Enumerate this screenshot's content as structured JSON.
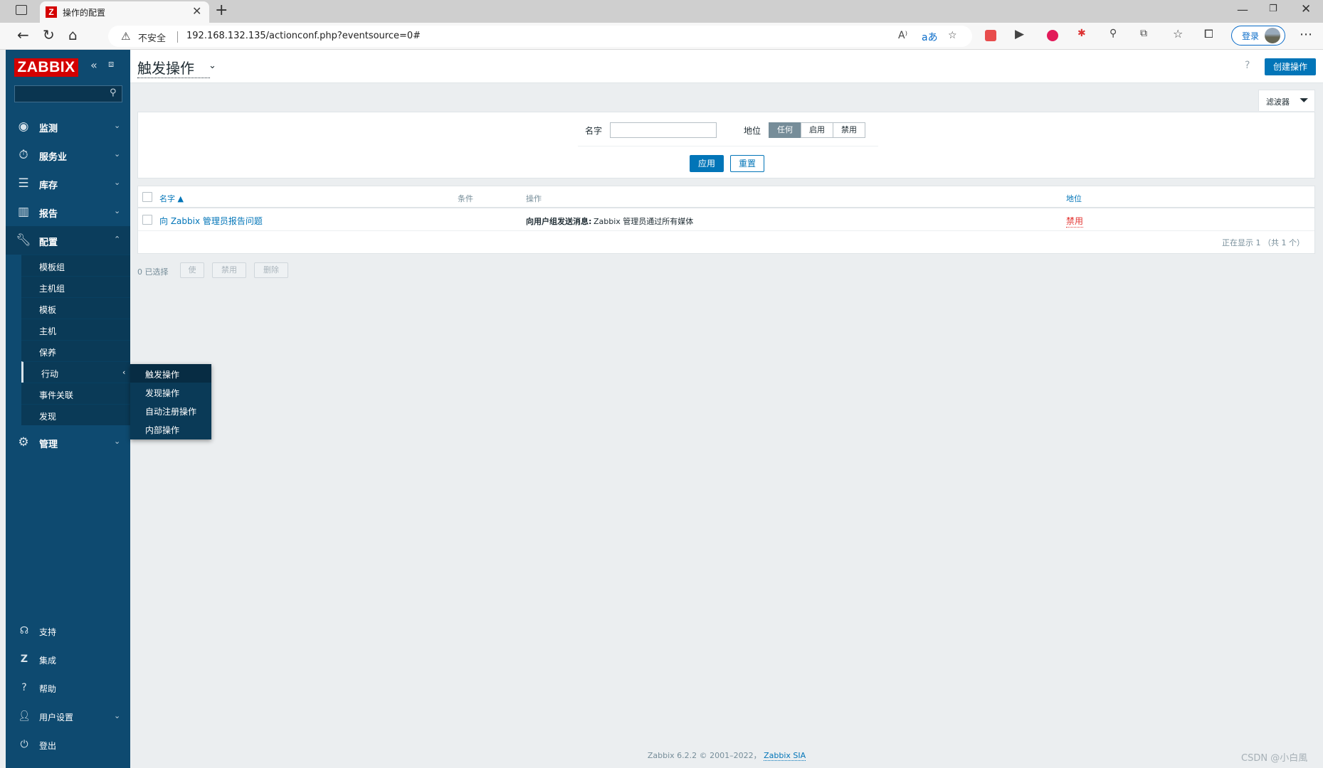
{
  "browser": {
    "tab_title": "操作的配置",
    "tab_favicon": "Z",
    "insecure_label": "不安全",
    "url": "192.168.132.135/actionconf.php?eventsource=0#",
    "login_label": "登录"
  },
  "sidebar": {
    "logo": "ZABBIX",
    "search_placeholder": "",
    "menu": [
      {
        "label": "监测",
        "icon": "eye-icon"
      },
      {
        "label": "服务业",
        "icon": "stopwatch-icon"
      },
      {
        "label": "库存",
        "icon": "list-icon"
      },
      {
        "label": "报告",
        "icon": "bar-chart-icon"
      },
      {
        "label": "配置",
        "icon": "wrench-icon"
      }
    ],
    "config_submenu": [
      "模板组",
      "主机组",
      "模板",
      "主机",
      "保养",
      "行动",
      "事件关联",
      "发现"
    ],
    "admin": {
      "label": "管理",
      "icon": "gear-icon"
    },
    "bottom": [
      {
        "label": "支持",
        "icon": "headset-icon"
      },
      {
        "label": "集成",
        "icon": "zabbix-z-icon"
      },
      {
        "label": "帮助",
        "icon": "question-icon"
      },
      {
        "label": "用户设置",
        "icon": "user-icon"
      },
      {
        "label": "登出",
        "icon": "power-icon"
      }
    ]
  },
  "flyout": [
    "触发操作",
    "发现操作",
    "自动注册操作",
    "内部操作"
  ],
  "header": {
    "title": "触发操作",
    "create_button": "创建操作"
  },
  "filter": {
    "tab_label": "滤波器",
    "name_label": "名字",
    "name_value": "",
    "status_label": "地位",
    "status_options": [
      "任何",
      "启用",
      "禁用"
    ],
    "status_selected": "任何",
    "apply": "应用",
    "reset": "重置"
  },
  "table": {
    "columns": [
      "名字 ▲",
      "条件",
      "操作",
      "地位"
    ],
    "rows": [
      {
        "name": "向 Zabbix 管理员报告问题",
        "conditions": "",
        "operation_label": "向用户组发送消息:",
        "operation_value": "Zabbix 管理员通过所有媒体",
        "status": "禁用"
      }
    ],
    "paging": "正在显示 1 （共 1 个）"
  },
  "mass_actions": {
    "selected": "0 已选择",
    "enable": "使",
    "disable": "禁用",
    "delete": "删除"
  },
  "footer": {
    "copyright": "Zabbix 6.2.2 © 2001–2022，",
    "company": "Zabbix SIA"
  },
  "watermark": "CSDN @小白風",
  "colors": {
    "sidebar": "#0e4a70",
    "primary": "#0275b8",
    "logo": "#d40000",
    "disabled_status": "#e33734"
  }
}
